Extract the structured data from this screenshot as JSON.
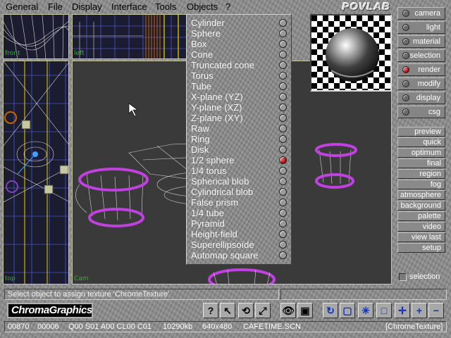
{
  "menubar": {
    "items": [
      "General",
      "File",
      "Display",
      "Interface",
      "Tools",
      "Objects",
      "?"
    ],
    "logo": "POVLAB"
  },
  "viewports": {
    "top_label": "top",
    "left_label": "left",
    "front_label": "front",
    "camera_label": "Cam"
  },
  "objects_menu": {
    "selected": "1/2 sphere",
    "items": [
      "Cylinder",
      "Sphere",
      "Box",
      "Cone",
      "Truncated cone",
      "Torus",
      "Tube",
      "X-plane (YZ)",
      "Y-plane (XZ)",
      "Z-plane (XY)",
      "Raw",
      "Ring",
      "Disk",
      "1/2 sphere",
      "1/4 torus",
      "Spherical blob",
      "Cylindrical blob",
      "False prism",
      "1/4 tube",
      "Pyramid",
      "Height-field",
      "Superellipsoïde",
      "Automap square"
    ]
  },
  "right_panel": {
    "mode_buttons": [
      {
        "label": "camera",
        "active": false
      },
      {
        "label": "light",
        "active": false
      },
      {
        "label": "material",
        "active": false
      },
      {
        "label": "selection",
        "active": false
      },
      {
        "label": "render",
        "active": true
      },
      {
        "label": "modify",
        "active": false
      },
      {
        "label": "display",
        "active": false
      },
      {
        "label": "csg",
        "active": false
      }
    ],
    "render_buttons": [
      "preview",
      "quick",
      "optimum",
      "final",
      "region",
      "fog",
      "atmosphere",
      "background",
      "palette",
      "video",
      "view last",
      "setup"
    ],
    "selection_checkbox": "selection"
  },
  "status": {
    "message": "Select object to assign texture 'ChromeTexture'"
  },
  "toolbar": {
    "brand": "ChromaGraphics",
    "icons": [
      "help-icon",
      "pointer-icon",
      "rotate-arrows-icon",
      "scale-icon",
      "eye-icon",
      "save-disk-icon",
      "refresh-icon",
      "frame-icon",
      "snowflake-icon",
      "square-icon",
      "crosshair-icon",
      "plus-icon",
      "minus-icon"
    ]
  },
  "info_bar": {
    "counter1": "00870",
    "counter2": "00006",
    "flags": "Q00 S01 A00 CL00 C01",
    "memory": "10290kb",
    "resolution": "640x480",
    "scene": "CAFETIME.SCN",
    "texture": "[ChromeTexture]"
  },
  "colors": {
    "selection_magenta": "#c040e0",
    "wireframe": "#d8d8d8",
    "grid_yellow": "#c8b400",
    "grid_blue": "#4858c8",
    "status_red": "#c00000"
  }
}
